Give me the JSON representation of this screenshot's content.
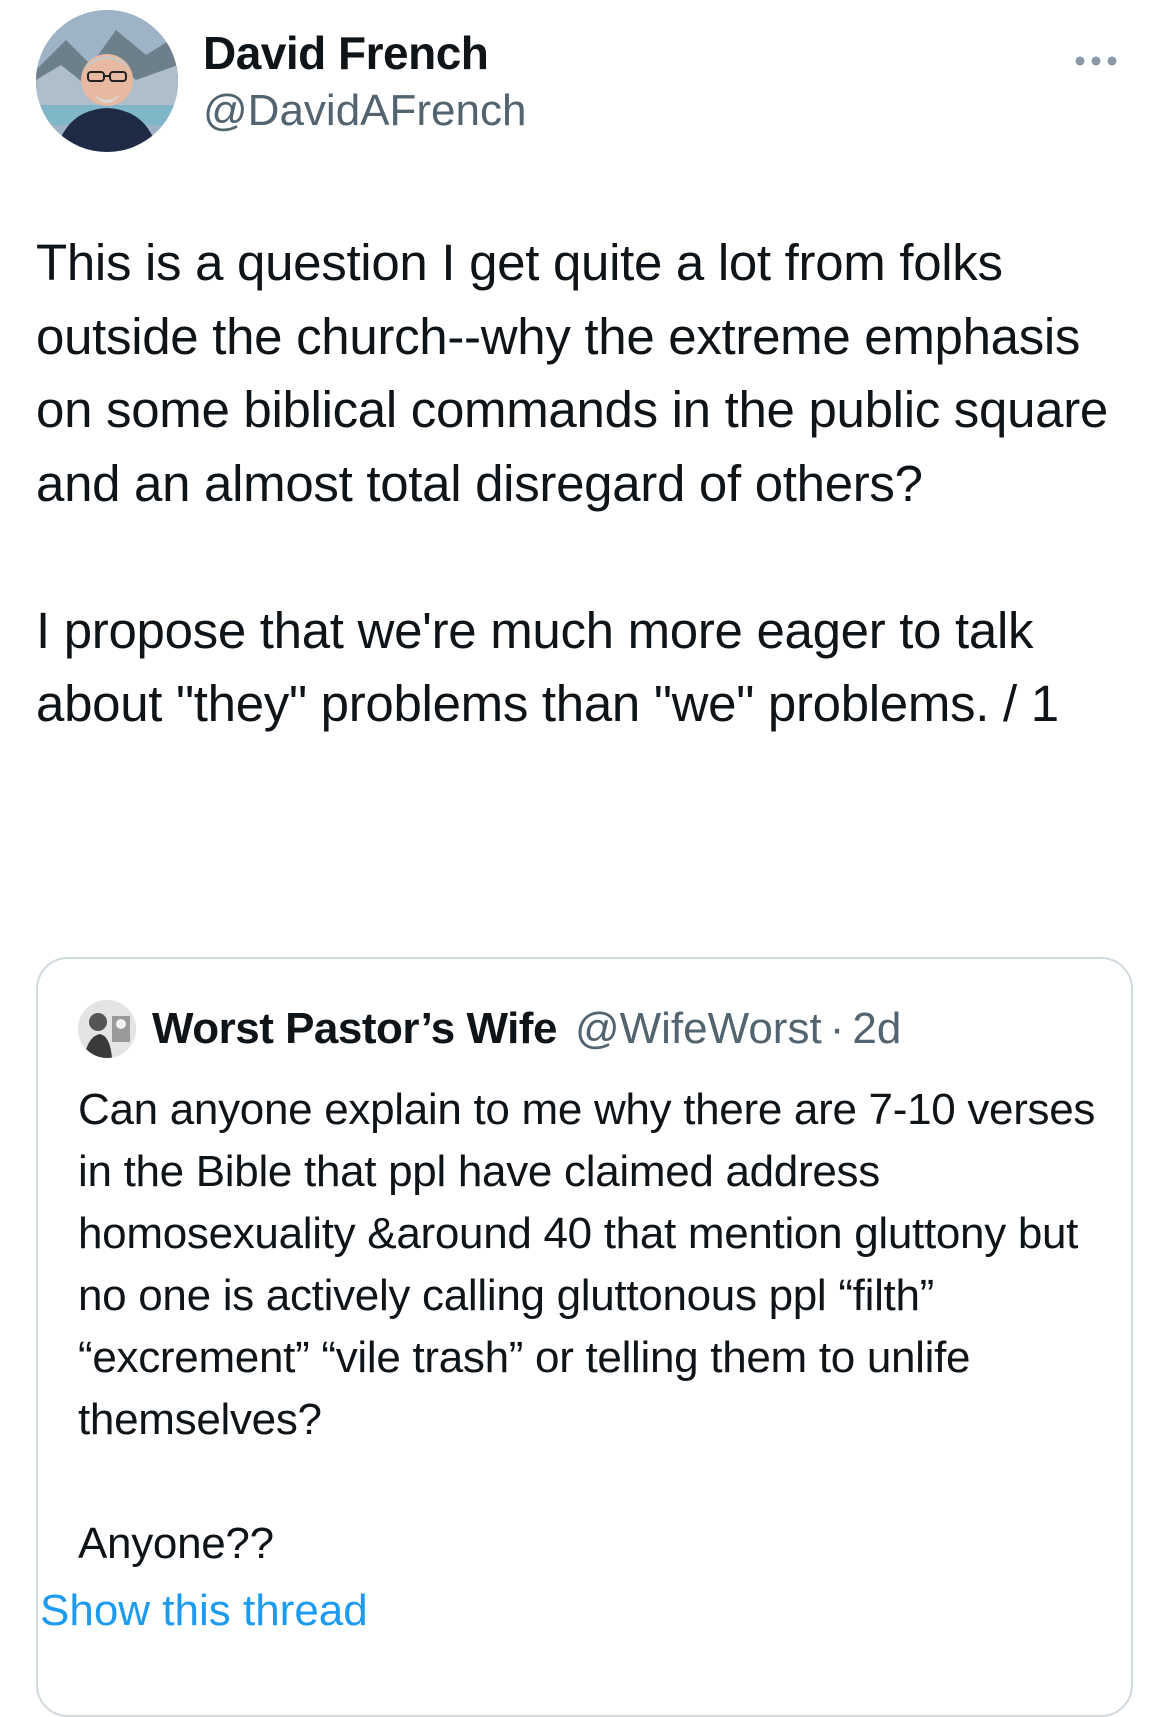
{
  "tweet": {
    "author": {
      "display_name": "David French",
      "handle": "@DavidAFrench"
    },
    "paragraphs": [
      "This is a question I get quite a lot from folks outside the church--why the extreme emphasis on some biblical commands in the public square and an almost total disregard of others?",
      "I propose that we're much more eager to talk about \"they\" problems than \"we\" problems. / 1"
    ]
  },
  "quote": {
    "author": {
      "display_name": "Worst Pastor’s Wife",
      "handle": "@WifeWorst",
      "separator": "·",
      "time": "2d"
    },
    "paragraphs": [
      "Can anyone explain to me why there are 7-10 verses in the Bible that ppl have claimed address homosexuality &around 40 that mention gluttony but no one is actively calling gluttonous ppl “filth” “excrement” “vile trash” or telling them to unlife themselves?",
      "Anyone??"
    ],
    "show_thread_label": "Show this thread"
  },
  "icons": {
    "more": "more-horizontal-icon"
  },
  "colors": {
    "text_primary": "#0f1419",
    "text_secondary": "#536471",
    "link": "#1d9bf0",
    "border": "#cfd9de"
  }
}
